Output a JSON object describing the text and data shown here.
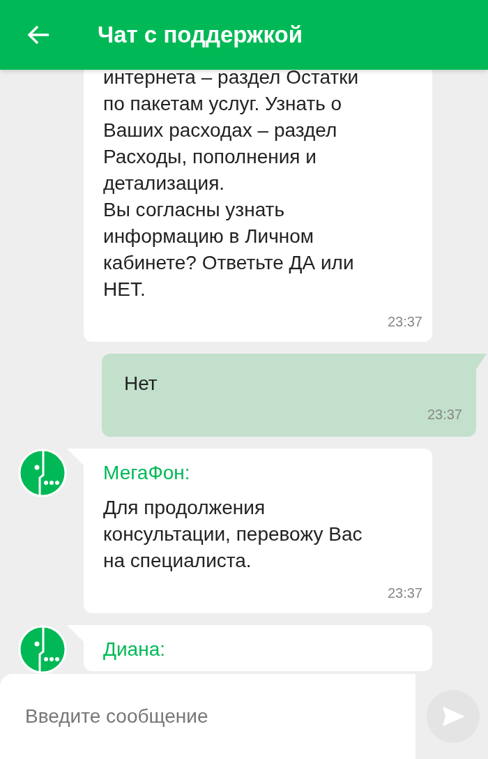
{
  "header": {
    "title": "Чат с поддержкой"
  },
  "messages": [
    {
      "kind": "incoming",
      "text": "интернета – раздел Остатки\nпо пакетам услуг. Узнать о\nВаших расходах – раздел\nРасходы, пополнения и\nдетализация.\nВы согласны узнать\nинформацию в Личном\nкабинете? Ответьте ДА или\nНЕТ.",
      "time": "23:37"
    },
    {
      "kind": "outgoing",
      "text": "Нет",
      "time": "23:37"
    },
    {
      "kind": "incoming",
      "sender": "МегаФон:",
      "text": "Для продолжения\nконсультации, перевожу Вас\nна специалиста.",
      "time": "23:37"
    },
    {
      "kind": "incoming",
      "sender": "Диана:"
    }
  ],
  "composer": {
    "placeholder": "Введите сообщение"
  }
}
